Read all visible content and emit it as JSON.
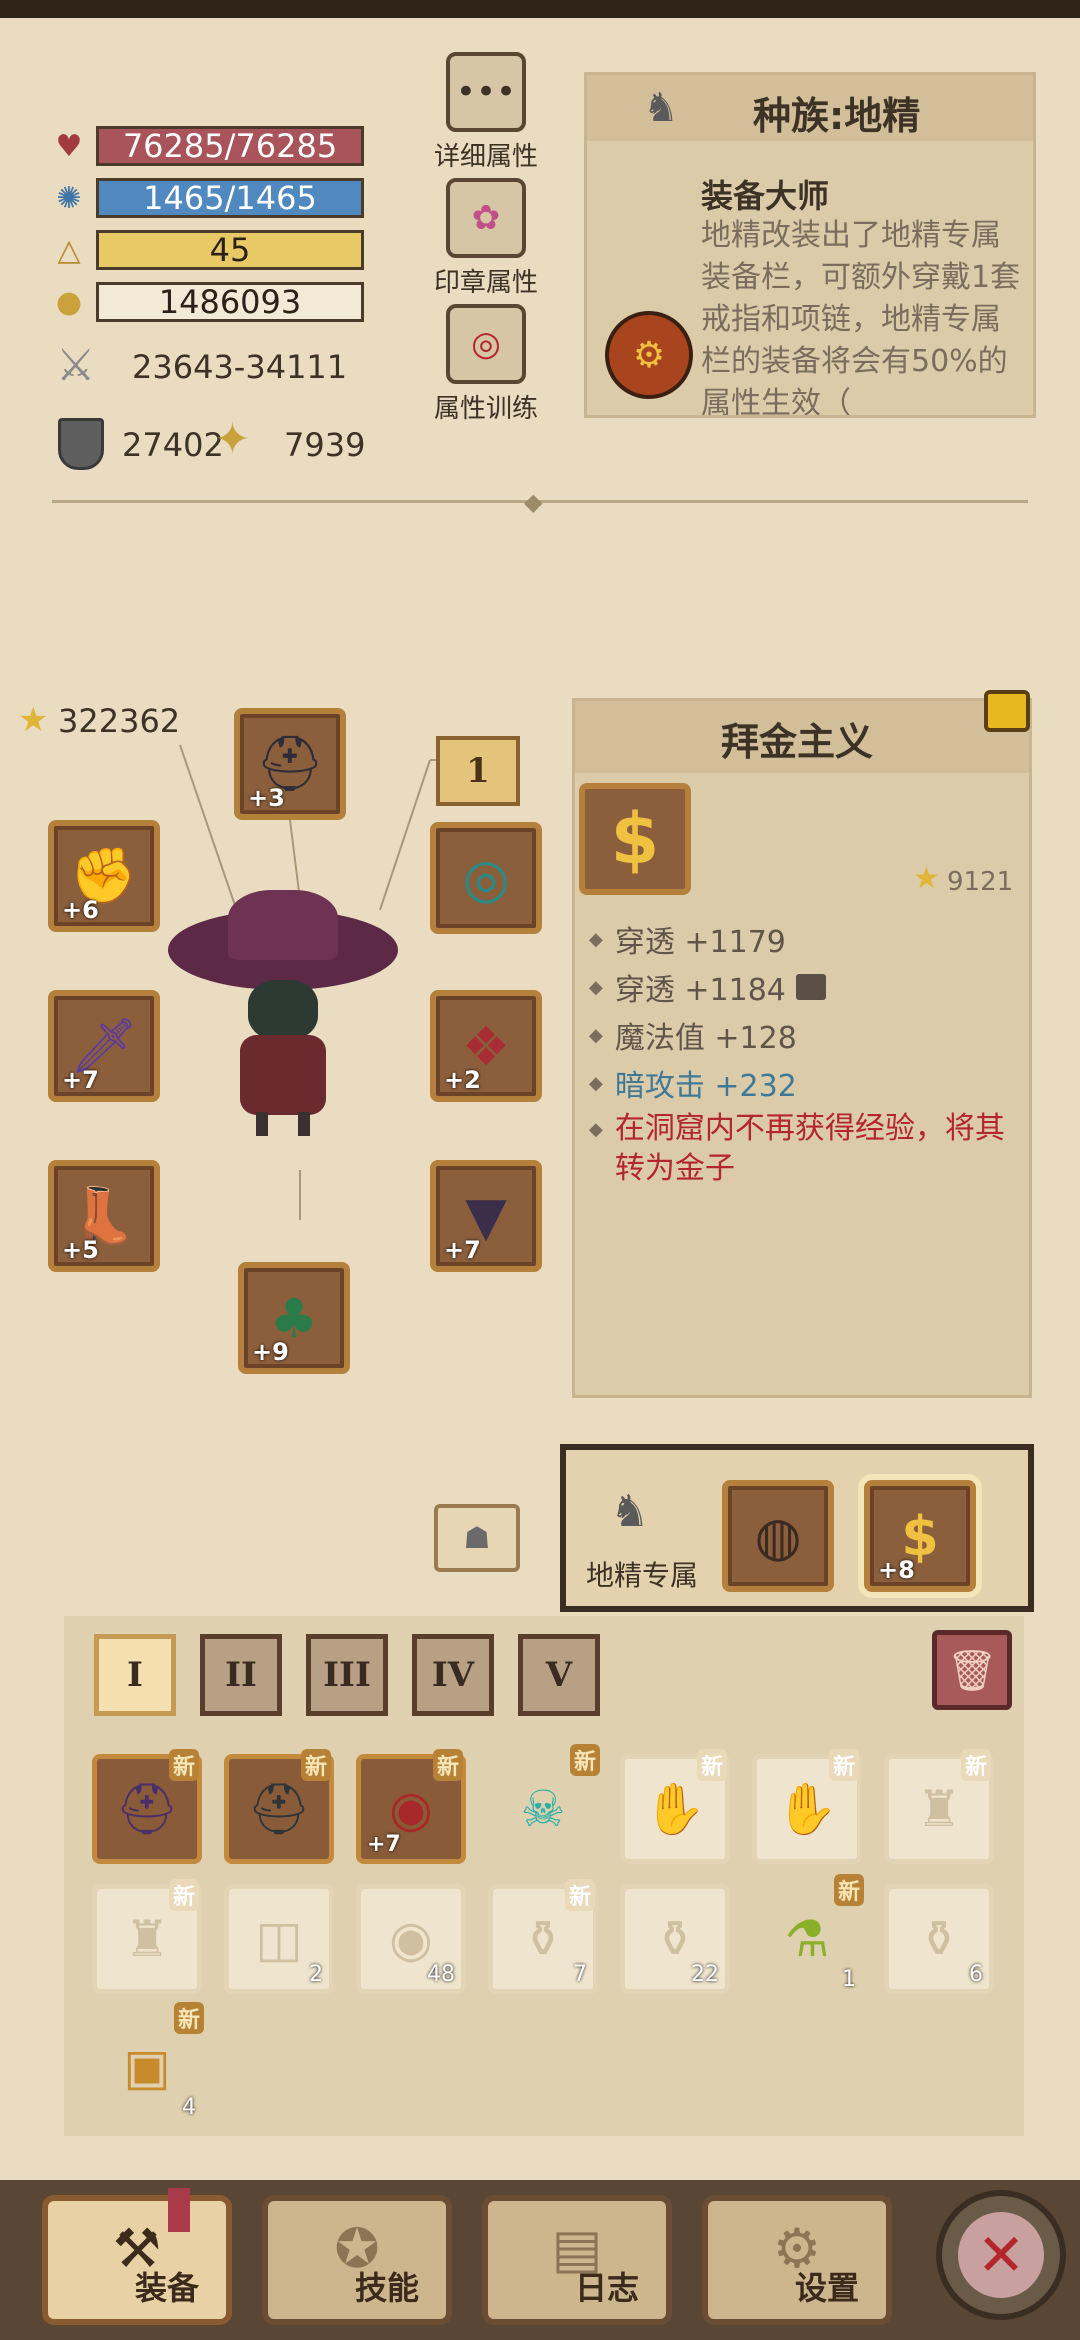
{
  "stats": {
    "hp": "76285/76285",
    "mp": "1465/1465",
    "level": "45",
    "gold": "1486093",
    "attack": "23643-34111",
    "armor": "27402",
    "magic": "7939"
  },
  "attr_buttons": [
    {
      "label": "详细属性"
    },
    {
      "label": "印章属性"
    },
    {
      "label": "属性训练"
    }
  ],
  "race_panel": {
    "title": "种族:地精",
    "skill_name": "装备大师",
    "skill_desc": "地精改装出了地精专属装备栏，可额外穿戴1套戒指和项链，地精专属栏的装备将会有50%的属性生效（"
  },
  "character": {
    "power": "322362",
    "slot_plus": {
      "helmet": "+3",
      "glove": "+6",
      "weapon": "+7",
      "boots": "+5",
      "chest": "+2",
      "legs": "+7",
      "cloak": "+9"
    },
    "set_page": "1"
  },
  "item_detail": {
    "name": "拜金主义",
    "power": "9121",
    "lines": [
      {
        "text": "穿透 +1179",
        "color": "#5f554a"
      },
      {
        "text": "穿透 +1184",
        "color": "#5f554a"
      },
      {
        "text": "魔法值 +128",
        "color": "#5f554a"
      },
      {
        "text": "暗攻击 +232",
        "color": "#3e7a98"
      },
      {
        "text": "在洞窟内不再获得经验，将其转为金子",
        "color": "#b3262b"
      }
    ]
  },
  "goblin_slot": {
    "label": "地精专属",
    "amulet_plus": "+8"
  },
  "inventory": {
    "tabs": [
      "I",
      "II",
      "III",
      "IV",
      "V"
    ],
    "new_badge": "新",
    "counts": [
      "2",
      "48",
      "7",
      "22",
      "1",
      "6",
      "4"
    ],
    "plus": "+7"
  },
  "nav": [
    {
      "label": "装备"
    },
    {
      "label": "技能"
    },
    {
      "label": "日志"
    },
    {
      "label": "设置"
    }
  ],
  "colors": {
    "background": "#e9dcc0",
    "hp": "#a8545a",
    "mp": "#4f89bf",
    "level": "#e8c966",
    "enchant": "#3e7a98",
    "special": "#b3262b"
  }
}
